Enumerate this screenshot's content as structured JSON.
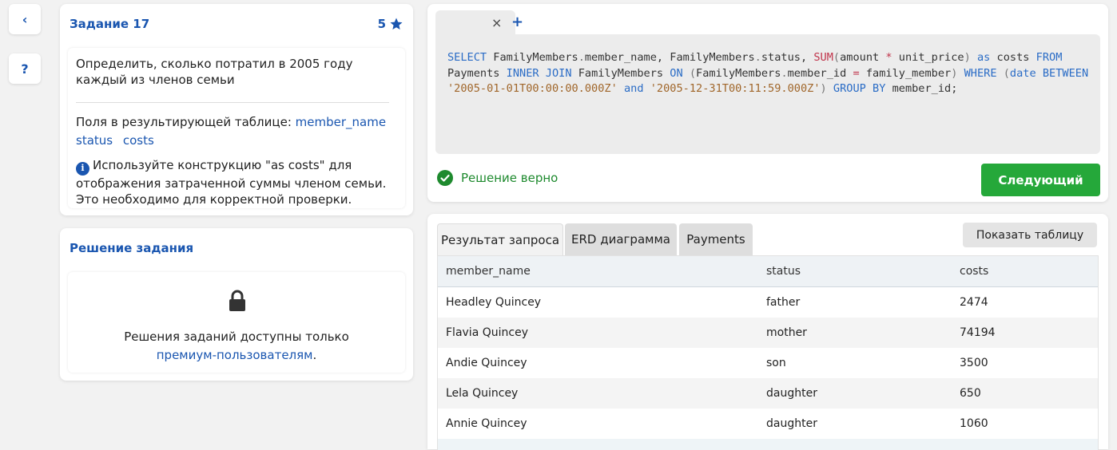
{
  "nav": {
    "back_label": "‹",
    "help_label": "?"
  },
  "task": {
    "title": "Задание 17",
    "rating": "5",
    "description": "Определить, сколько потратил в 2005 году каждый из членов семьи",
    "fields_label": "Поля в результирующей таблице:",
    "fields": [
      "member_name",
      "status",
      "costs"
    ],
    "hint": "Используйте конструкцию \"as costs\" для отображения затраченной суммы членом семьи. Это необходимо для корректной проверки."
  },
  "solution": {
    "title": "Решение задания",
    "text_before": "Решения заданий доступны только",
    "link": "премиум-пользователям",
    "text_after": "."
  },
  "editor": {
    "close_label": "×",
    "add_label": "+",
    "tokens": [
      {
        "t": "SELECT",
        "c": "kw"
      },
      {
        "t": " FamilyMembers",
        "c": ""
      },
      {
        "t": ".",
        "c": "pn"
      },
      {
        "t": "member_name, FamilyMembers",
        "c": ""
      },
      {
        "t": ".",
        "c": "pn"
      },
      {
        "t": "status, ",
        "c": ""
      },
      {
        "t": "SUM",
        "c": "fn"
      },
      {
        "t": "(",
        "c": "pn"
      },
      {
        "t": "amount ",
        "c": ""
      },
      {
        "t": "*",
        "c": "op"
      },
      {
        "t": " unit_price",
        "c": ""
      },
      {
        "t": ")",
        "c": "pn"
      },
      {
        "t": " ",
        "c": ""
      },
      {
        "t": "as",
        "c": "kw"
      },
      {
        "t": " costs ",
        "c": ""
      },
      {
        "t": "FROM",
        "c": "kw"
      },
      {
        "t": " Payments ",
        "c": ""
      },
      {
        "t": "INNER JOIN",
        "c": "kw"
      },
      {
        "t": " FamilyMembers ",
        "c": ""
      },
      {
        "t": "ON",
        "c": "kw"
      },
      {
        "t": " ",
        "c": ""
      },
      {
        "t": "(",
        "c": "pn"
      },
      {
        "t": "FamilyMembers",
        "c": ""
      },
      {
        "t": ".",
        "c": "pn"
      },
      {
        "t": "member_id ",
        "c": ""
      },
      {
        "t": "=",
        "c": "op"
      },
      {
        "t": " family_member",
        "c": ""
      },
      {
        "t": ")",
        "c": "pn"
      },
      {
        "t": " ",
        "c": ""
      },
      {
        "t": "WHERE",
        "c": "kw"
      },
      {
        "t": " ",
        "c": ""
      },
      {
        "t": "(",
        "c": "pn"
      },
      {
        "t": "date",
        "c": "kw"
      },
      {
        "t": " ",
        "c": ""
      },
      {
        "t": "BETWEEN",
        "c": "kw"
      },
      {
        "t": " ",
        "c": ""
      },
      {
        "t": "'2005-01-01T00:00:00.000Z'",
        "c": "str"
      },
      {
        "t": " ",
        "c": ""
      },
      {
        "t": "and",
        "c": "kw"
      },
      {
        "t": " ",
        "c": ""
      },
      {
        "t": "'2005-12-31T00:11:59.000Z'",
        "c": "str"
      },
      {
        "t": ")",
        "c": "pn"
      },
      {
        "t": " ",
        "c": ""
      },
      {
        "t": "GROUP BY",
        "c": "kw"
      },
      {
        "t": " member_id;",
        "c": ""
      }
    ],
    "status": "Решение верно",
    "next_label": "Следующий"
  },
  "result": {
    "tabs": [
      "Результат запроса",
      "ERD диаграмма",
      "Payments"
    ],
    "show_table_label": "Показать таблицу",
    "columns": [
      "member_name",
      "status",
      "costs"
    ],
    "rows": [
      [
        "Headley Quincey",
        "father",
        "2474"
      ],
      [
        "Flavia Quincey",
        "mother",
        "74194"
      ],
      [
        "Andie Quincey",
        "son",
        "3500"
      ],
      [
        "Lela Quincey",
        "daughter",
        "650"
      ],
      [
        "Annie Quincey",
        "daughter",
        "1060"
      ]
    ]
  },
  "colors": {
    "accent": "#1a56b0",
    "success": "#25a83a",
    "success_text": "#1e8a2e"
  }
}
